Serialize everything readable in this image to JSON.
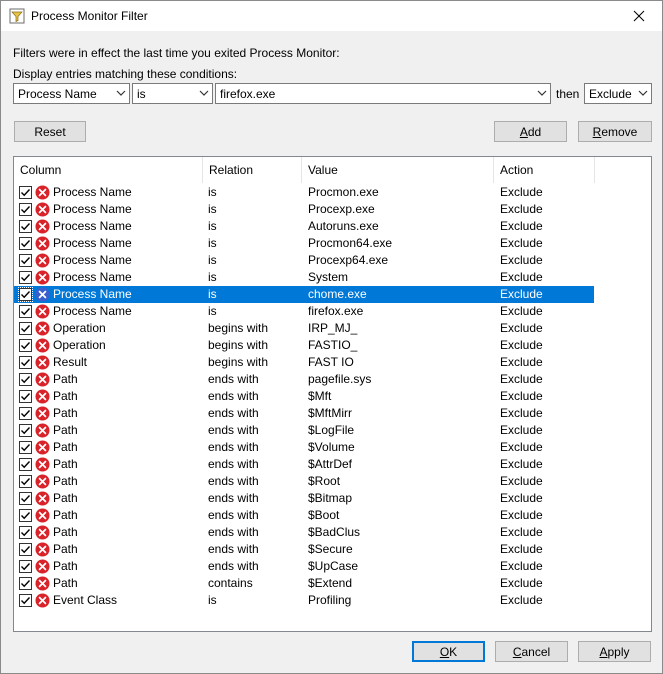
{
  "window": {
    "title": "Process Monitor Filter"
  },
  "intro_text": "Filters were in effect the last time you exited Process Monitor:",
  "conditions_label": "Display entries matching these conditions:",
  "editor": {
    "column_value": "Process Name",
    "relation_value": "is",
    "value_text": "firefox.exe",
    "then_label": "then",
    "action_value": "Exclude"
  },
  "buttons": {
    "reset": "Reset",
    "add_prefix": "",
    "add_access": "A",
    "add_rest": "dd",
    "remove_prefix": "",
    "remove_access": "R",
    "remove_rest": "emove",
    "ok_prefix": "",
    "ok_access": "O",
    "ok_rest": "K",
    "cancel_prefix": "",
    "cancel_access": "C",
    "cancel_rest": "ancel",
    "apply_prefix": "",
    "apply_access": "A",
    "apply_rest": "pply"
  },
  "columns": [
    "Column",
    "Relation",
    "Value",
    "Action"
  ],
  "colors": {
    "exclude_icon": "#d8232a",
    "selected_icon": "#3a5fcd",
    "selection": "#0078d7"
  },
  "rows": [
    {
      "column": "Process Name",
      "relation": "is",
      "value": "Procmon.exe",
      "action": "Exclude",
      "checked": true,
      "selected": false,
      "icon": "exclude-icon"
    },
    {
      "column": "Process Name",
      "relation": "is",
      "value": "Procexp.exe",
      "action": "Exclude",
      "checked": true,
      "selected": false,
      "icon": "exclude-icon"
    },
    {
      "column": "Process Name",
      "relation": "is",
      "value": "Autoruns.exe",
      "action": "Exclude",
      "checked": true,
      "selected": false,
      "icon": "exclude-icon"
    },
    {
      "column": "Process Name",
      "relation": "is",
      "value": "Procmon64.exe",
      "action": "Exclude",
      "checked": true,
      "selected": false,
      "icon": "exclude-icon"
    },
    {
      "column": "Process Name",
      "relation": "is",
      "value": "Procexp64.exe",
      "action": "Exclude",
      "checked": true,
      "selected": false,
      "icon": "exclude-icon"
    },
    {
      "column": "Process Name",
      "relation": "is",
      "value": "System",
      "action": "Exclude",
      "checked": true,
      "selected": false,
      "icon": "exclude-icon"
    },
    {
      "column": "Process Name",
      "relation": "is",
      "value": "chome.exe",
      "action": "Exclude",
      "checked": true,
      "selected": true,
      "icon": "exclude-icon"
    },
    {
      "column": "Process Name",
      "relation": "is",
      "value": "firefox.exe",
      "action": "Exclude",
      "checked": true,
      "selected": false,
      "icon": "exclude-icon"
    },
    {
      "column": "Operation",
      "relation": "begins with",
      "value": "IRP_MJ_",
      "action": "Exclude",
      "checked": true,
      "selected": false,
      "icon": "exclude-icon"
    },
    {
      "column": "Operation",
      "relation": "begins with",
      "value": "FASTIO_",
      "action": "Exclude",
      "checked": true,
      "selected": false,
      "icon": "exclude-icon"
    },
    {
      "column": "Result",
      "relation": "begins with",
      "value": "FAST IO",
      "action": "Exclude",
      "checked": true,
      "selected": false,
      "icon": "exclude-icon"
    },
    {
      "column": "Path",
      "relation": "ends with",
      "value": "pagefile.sys",
      "action": "Exclude",
      "checked": true,
      "selected": false,
      "icon": "exclude-icon"
    },
    {
      "column": "Path",
      "relation": "ends with",
      "value": "$Mft",
      "action": "Exclude",
      "checked": true,
      "selected": false,
      "icon": "exclude-icon"
    },
    {
      "column": "Path",
      "relation": "ends with",
      "value": "$MftMirr",
      "action": "Exclude",
      "checked": true,
      "selected": false,
      "icon": "exclude-icon"
    },
    {
      "column": "Path",
      "relation": "ends with",
      "value": "$LogFile",
      "action": "Exclude",
      "checked": true,
      "selected": false,
      "icon": "exclude-icon"
    },
    {
      "column": "Path",
      "relation": "ends with",
      "value": "$Volume",
      "action": "Exclude",
      "checked": true,
      "selected": false,
      "icon": "exclude-icon"
    },
    {
      "column": "Path",
      "relation": "ends with",
      "value": "$AttrDef",
      "action": "Exclude",
      "checked": true,
      "selected": false,
      "icon": "exclude-icon"
    },
    {
      "column": "Path",
      "relation": "ends with",
      "value": "$Root",
      "action": "Exclude",
      "checked": true,
      "selected": false,
      "icon": "exclude-icon"
    },
    {
      "column": "Path",
      "relation": "ends with",
      "value": "$Bitmap",
      "action": "Exclude",
      "checked": true,
      "selected": false,
      "icon": "exclude-icon"
    },
    {
      "column": "Path",
      "relation": "ends with",
      "value": "$Boot",
      "action": "Exclude",
      "checked": true,
      "selected": false,
      "icon": "exclude-icon"
    },
    {
      "column": "Path",
      "relation": "ends with",
      "value": "$BadClus",
      "action": "Exclude",
      "checked": true,
      "selected": false,
      "icon": "exclude-icon"
    },
    {
      "column": "Path",
      "relation": "ends with",
      "value": "$Secure",
      "action": "Exclude",
      "checked": true,
      "selected": false,
      "icon": "exclude-icon"
    },
    {
      "column": "Path",
      "relation": "ends with",
      "value": "$UpCase",
      "action": "Exclude",
      "checked": true,
      "selected": false,
      "icon": "exclude-icon"
    },
    {
      "column": "Path",
      "relation": "contains",
      "value": "$Extend",
      "action": "Exclude",
      "checked": true,
      "selected": false,
      "icon": "exclude-icon"
    },
    {
      "column": "Event Class",
      "relation": "is",
      "value": "Profiling",
      "action": "Exclude",
      "checked": true,
      "selected": false,
      "icon": "exclude-icon"
    }
  ]
}
